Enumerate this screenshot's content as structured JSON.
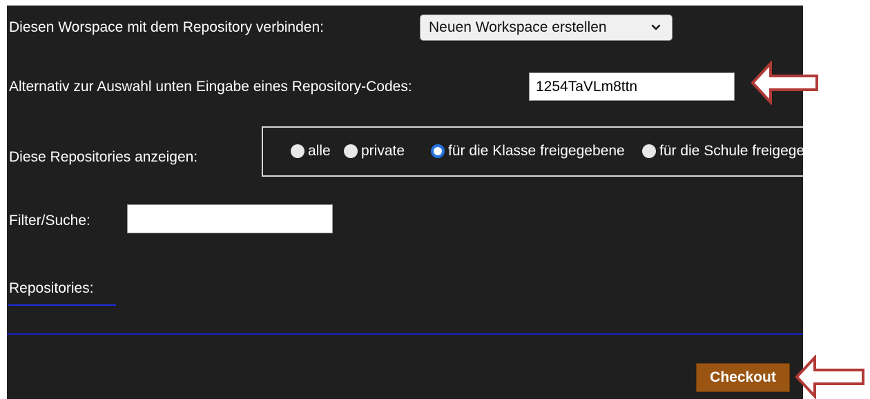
{
  "workspace": {
    "label": "Diesen Worspace mit dem Repository verbinden:",
    "selected_option": "Neuen Workspace erstellen"
  },
  "repo_code": {
    "label": "Alternativ zur Auswahl unten Eingabe eines Repository-Codes:",
    "value": "1254TaVLm8ttn"
  },
  "repo_filter": {
    "label": "Diese Repositories anzeigen:",
    "options": [
      {
        "label": "alle",
        "checked": false
      },
      {
        "label": "private",
        "checked": false
      },
      {
        "label": "für die Klasse freigegebene",
        "checked": true
      },
      {
        "label": "für die Schule freigegebene",
        "checked": false
      }
    ]
  },
  "search": {
    "label": "Filter/Suche:",
    "value": ""
  },
  "repositories": {
    "heading": "Repositories:"
  },
  "actions": {
    "checkout_label": "Checkout"
  },
  "colors": {
    "panel_bg": "#1f1f1f",
    "radio_accent": "#2573e0",
    "checkout_bg": "#9a5512",
    "divider": "#1a22c8",
    "annotation_arrow": "#b23a36"
  },
  "icons": {
    "select_chevron": "chevron-down-icon",
    "annotation": "arrow-left-icon"
  }
}
